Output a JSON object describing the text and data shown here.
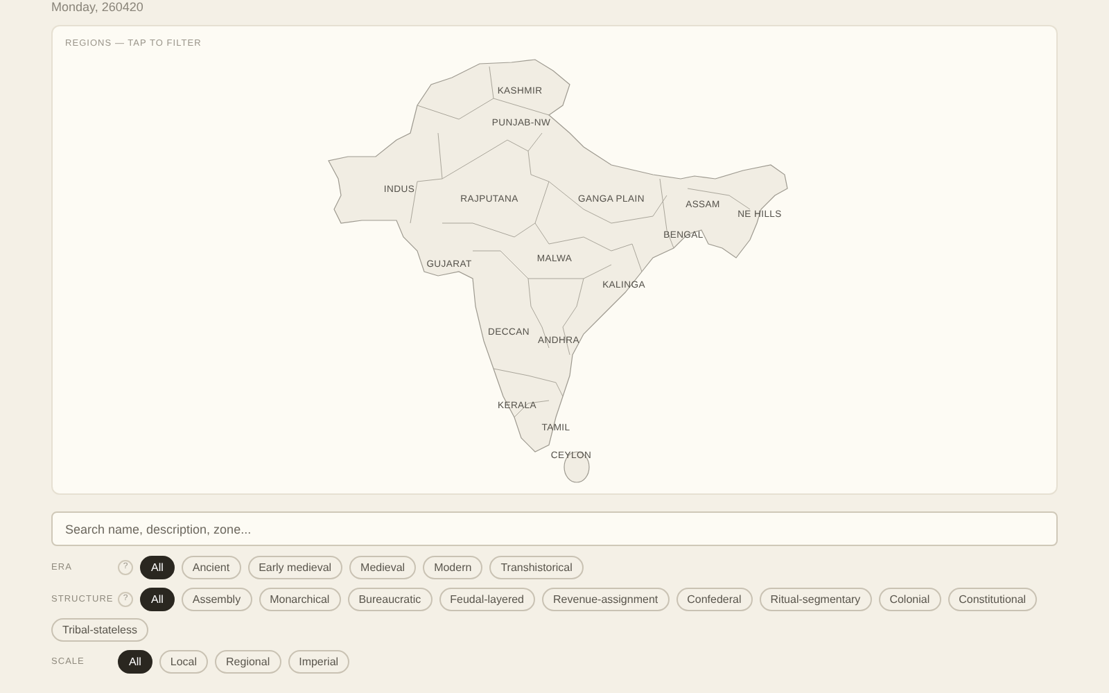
{
  "date": "Monday, 260420",
  "map": {
    "caption": "REGIONS — TAP TO FILTER",
    "regions": [
      "KASHMIR",
      "PUNJAB-NW",
      "INDUS",
      "RAJPUTANA",
      "GANGA PLAIN",
      "ASSAM",
      "NE HILLS",
      "BENGAL",
      "GUJARAT",
      "MALWA",
      "KALINGA",
      "DECCAN",
      "ANDHRA",
      "KERALA",
      "TAMIL",
      "CEYLON"
    ]
  },
  "search": {
    "placeholder": "Search name, description, zone..."
  },
  "filters": [
    {
      "label": "ERA",
      "help": "?",
      "options": [
        {
          "label": "All",
          "selected": true
        },
        {
          "label": "Ancient",
          "selected": false
        },
        {
          "label": "Early medieval",
          "selected": false
        },
        {
          "label": "Medieval",
          "selected": false
        },
        {
          "label": "Modern",
          "selected": false
        },
        {
          "label": "Transhistorical",
          "selected": false
        }
      ]
    },
    {
      "label": "STRUCTURE",
      "help": "?",
      "options": [
        {
          "label": "All",
          "selected": true
        },
        {
          "label": "Assembly",
          "selected": false
        },
        {
          "label": "Monarchical",
          "selected": false
        },
        {
          "label": "Bureaucratic",
          "selected": false
        },
        {
          "label": "Feudal-layered",
          "selected": false
        },
        {
          "label": "Revenue-assignment",
          "selected": false
        },
        {
          "label": "Confederal",
          "selected": false
        },
        {
          "label": "Ritual-segmentary",
          "selected": false
        },
        {
          "label": "Colonial",
          "selected": false
        },
        {
          "label": "Constitutional",
          "selected": false
        },
        {
          "label": "Tribal-stateless",
          "selected": false
        }
      ]
    },
    {
      "label": "SCALE",
      "options": [
        {
          "label": "All",
          "selected": true
        },
        {
          "label": "Local",
          "selected": false
        },
        {
          "label": "Regional",
          "selected": false
        },
        {
          "label": "Imperial",
          "selected": false
        }
      ]
    }
  ]
}
